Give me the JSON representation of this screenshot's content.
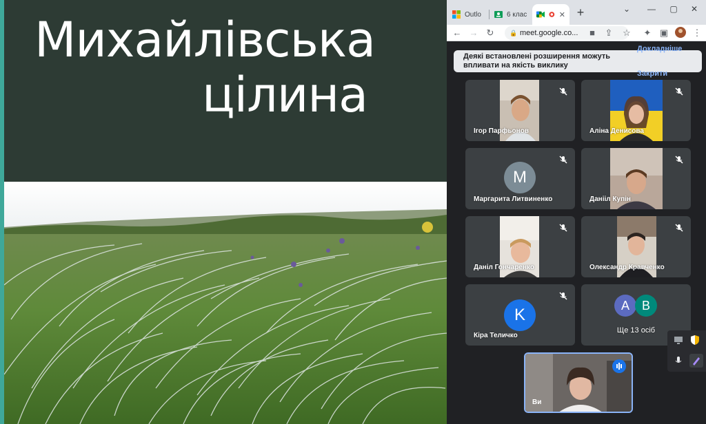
{
  "slide": {
    "title_line1": "Михайлівська",
    "title_line2": "цілина"
  },
  "browser": {
    "tabs": [
      {
        "label": "Outlo",
        "icon": "microsoft-icon"
      },
      {
        "label": "6 клас",
        "icon": "classroom-icon"
      },
      {
        "label": "",
        "icon": "meet-icon",
        "recording": true
      }
    ],
    "new_tab": "+",
    "url": "meet.google.co..."
  },
  "meet": {
    "banner": {
      "text": "Деякі встановлені розширення можуть впливати на якість виклику",
      "more_label": "Докладніше",
      "close_label": "Закрити"
    },
    "participants": [
      {
        "name": "Ігор Парфьонов",
        "video": true,
        "muted": true
      },
      {
        "name": "Аліна Денисова",
        "video": true,
        "muted": true
      },
      {
        "name": "Маргарита Литвиненко",
        "avatar": "M",
        "avatar_color": "#7c8c96",
        "muted": true
      },
      {
        "name": "Данііл Купін",
        "video": true,
        "muted": true
      },
      {
        "name": "Даніл Гончаренко",
        "video": true,
        "muted": true
      },
      {
        "name": "Олександр Кравченко",
        "video": true,
        "muted": true
      },
      {
        "name": "Кіра Теличко",
        "avatar": "K",
        "avatar_color": "#1a73e8",
        "muted": true
      }
    ],
    "others": {
      "label": "Ще 13 осіб",
      "avatars": [
        {
          "letter": "A",
          "color": "#5c6bc0"
        },
        {
          "letter": "B",
          "color": "#00897b"
        }
      ]
    },
    "self": {
      "name": "Ви"
    }
  },
  "colors": {
    "slide_bg": "#2d3b34",
    "meet_bg": "#202124",
    "tile_bg": "#3c4043",
    "link": "#8ab4f8"
  }
}
